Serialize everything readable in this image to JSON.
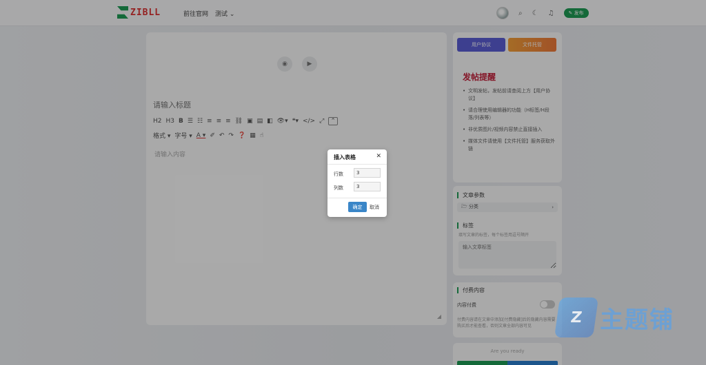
{
  "header": {
    "logo_text": "ZIBLL",
    "nav": [
      {
        "label": "前往官网"
      },
      {
        "label": "测试 ⌄"
      }
    ],
    "publish_label": "✎ 发布"
  },
  "editor": {
    "title_placeholder": "请输入标题",
    "toolbar_row1": [
      "H2",
      "H3",
      "B",
      "☰",
      "☷",
      "≡",
      "≡",
      "≡",
      "⛓",
      "▣",
      "▤",
      "◧",
      "👁▾",
      "❝▾",
      "</>",
      "⤢",
      "⌃"
    ],
    "toolbar_row2": [
      "格式 ▾",
      "字号 ▾",
      "A ▾",
      "✐",
      "↶",
      "↷",
      "❓",
      "▦",
      "☝"
    ],
    "content_placeholder": "请输入内容"
  },
  "sidebar": {
    "btn_user": "用户协议",
    "btn_file": "文件托管",
    "tips_title": "发帖提醒",
    "tips": [
      "文明发帖，发帖前请查阅上方【用户协议】",
      "请合理使用编辑器的功能（H标签/H段落/列表等）",
      "非优质图片/视频内容禁止直接插入",
      "媒体文件请使用【文件托管】服务获取外链"
    ],
    "params_label": "文章参数",
    "category_label": "🗁 分类",
    "tags_label": "标签",
    "tags_help": "填写文章的标签，每个标签用逗号隔开",
    "tags_placeholder": "输入文章标签",
    "pay_section_label": "付费内容",
    "pay_toggle_label": "内容付费",
    "pay_help": "付费内容请在文章中添加[付费隐藏]后的隐藏内容需要购买后才能查看，否则文章全部内容可见",
    "bottom_text": "Are you ready"
  },
  "modal": {
    "title": "插入表格",
    "close": "✕",
    "rows_label": "行数",
    "rows_value": "3",
    "cols_label": "列数",
    "cols_value": "3",
    "ok_label": "确定",
    "cancel_label": "取消"
  },
  "watermark": {
    "mark": "Z",
    "text": "主题铺"
  },
  "colors": {
    "brand_green": "#1f9d55",
    "tips_red": "#c5213c",
    "ok_blue": "#3a86c8",
    "user_btn": "#5b5fd6",
    "file_btn": "#f07a3b"
  }
}
